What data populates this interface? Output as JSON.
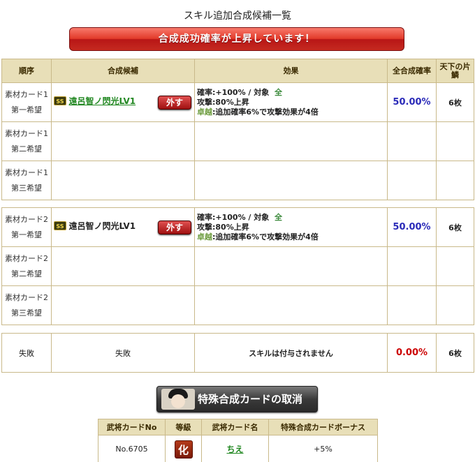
{
  "page_title": "スキル追加合成候補一覧",
  "banner_text": "合成成功確率が上昇しています！",
  "headers": {
    "order": "順序",
    "candidate": "合成候補",
    "effect": "効果",
    "rate": "全合成確率",
    "count": "天下の片鱗"
  },
  "groups": [
    {
      "rows": [
        {
          "order_line1": "素材カード1",
          "order_line2": "第一希望",
          "rank": "SS",
          "skill": "遠呂智ノ閃光LV1",
          "remove": "外す",
          "eff_line1": "確率:+100% / 対象",
          "eff_target": "全",
          "eff_line2": "攻撃:80%上昇",
          "eff_excel": "卓越",
          "eff_line3": ":追加確率6%で攻撃効果が4倍",
          "rate": "50.00%",
          "count": "6枚"
        },
        {
          "order_line1": "素材カード1",
          "order_line2": "第二希望"
        },
        {
          "order_line1": "素材カード1",
          "order_line2": "第三希望"
        }
      ]
    },
    {
      "rows": [
        {
          "order_line1": "素材カード2",
          "order_line2": "第一希望",
          "rank": "SS",
          "skill": "遠呂智ノ閃光LV1",
          "remove": "外す",
          "eff_line1": "確率:+100% / 対象",
          "eff_target": "全",
          "eff_line2": "攻撃:80%上昇",
          "eff_excel": "卓越",
          "eff_line3": ":追加確率6%で攻撃効果が4倍",
          "rate": "50.00%",
          "count": "6枚"
        },
        {
          "order_line1": "素材カード2",
          "order_line2": "第二希望"
        },
        {
          "order_line1": "素材カード2",
          "order_line2": "第三希望"
        }
      ]
    }
  ],
  "fail_row": {
    "order": "失敗",
    "candidate": "失敗",
    "effect": "スキルは付与されません",
    "rate": "0.00%",
    "count": "6枚"
  },
  "cancel_button": "特殊合成カードの取消",
  "bonus_table": {
    "headers": [
      "武将カードNo",
      "等級",
      "武将カード名",
      "特殊合成カードボーナス"
    ],
    "row": {
      "no": "No.6705",
      "grade": "化",
      "name": "ちえ",
      "bonus": "+5%"
    }
  },
  "colors": {
    "header_bg": "#e8dfb8",
    "border": "#c9b98a",
    "rate_blue": "#2a2ab8",
    "rate_red": "#cc0000",
    "banner_red": "#c52a20"
  }
}
